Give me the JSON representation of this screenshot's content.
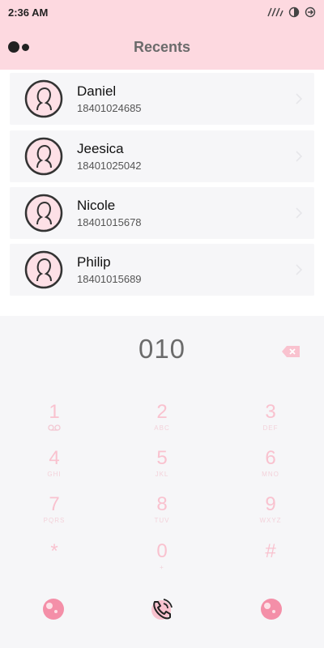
{
  "status": {
    "time": "2:36 AM"
  },
  "header": {
    "title": "Recents"
  },
  "recents": [
    {
      "name": "Daniel",
      "number": "18401024685"
    },
    {
      "name": "Jeesica",
      "number": "18401025042"
    },
    {
      "name": "Nicole",
      "number": "18401015678"
    },
    {
      "name": "Philip",
      "number": "18401015689"
    }
  ],
  "dialer": {
    "entered": "010",
    "keys": [
      {
        "digit": "1",
        "sub": ""
      },
      {
        "digit": "2",
        "sub": "ABC"
      },
      {
        "digit": "3",
        "sub": "DEF"
      },
      {
        "digit": "4",
        "sub": "GHI"
      },
      {
        "digit": "5",
        "sub": "JKL"
      },
      {
        "digit": "6",
        "sub": "MNO"
      },
      {
        "digit": "7",
        "sub": "PQRS"
      },
      {
        "digit": "8",
        "sub": "TUV"
      },
      {
        "digit": "9",
        "sub": "WXYZ"
      },
      {
        "digit": "*",
        "sub": ""
      },
      {
        "digit": "0",
        "sub": "+"
      },
      {
        "digit": "#",
        "sub": ""
      }
    ]
  },
  "colors": {
    "accent": "#fdd9e0",
    "key": "#f9c2cf",
    "bottom_icon": "#f48fa8"
  }
}
